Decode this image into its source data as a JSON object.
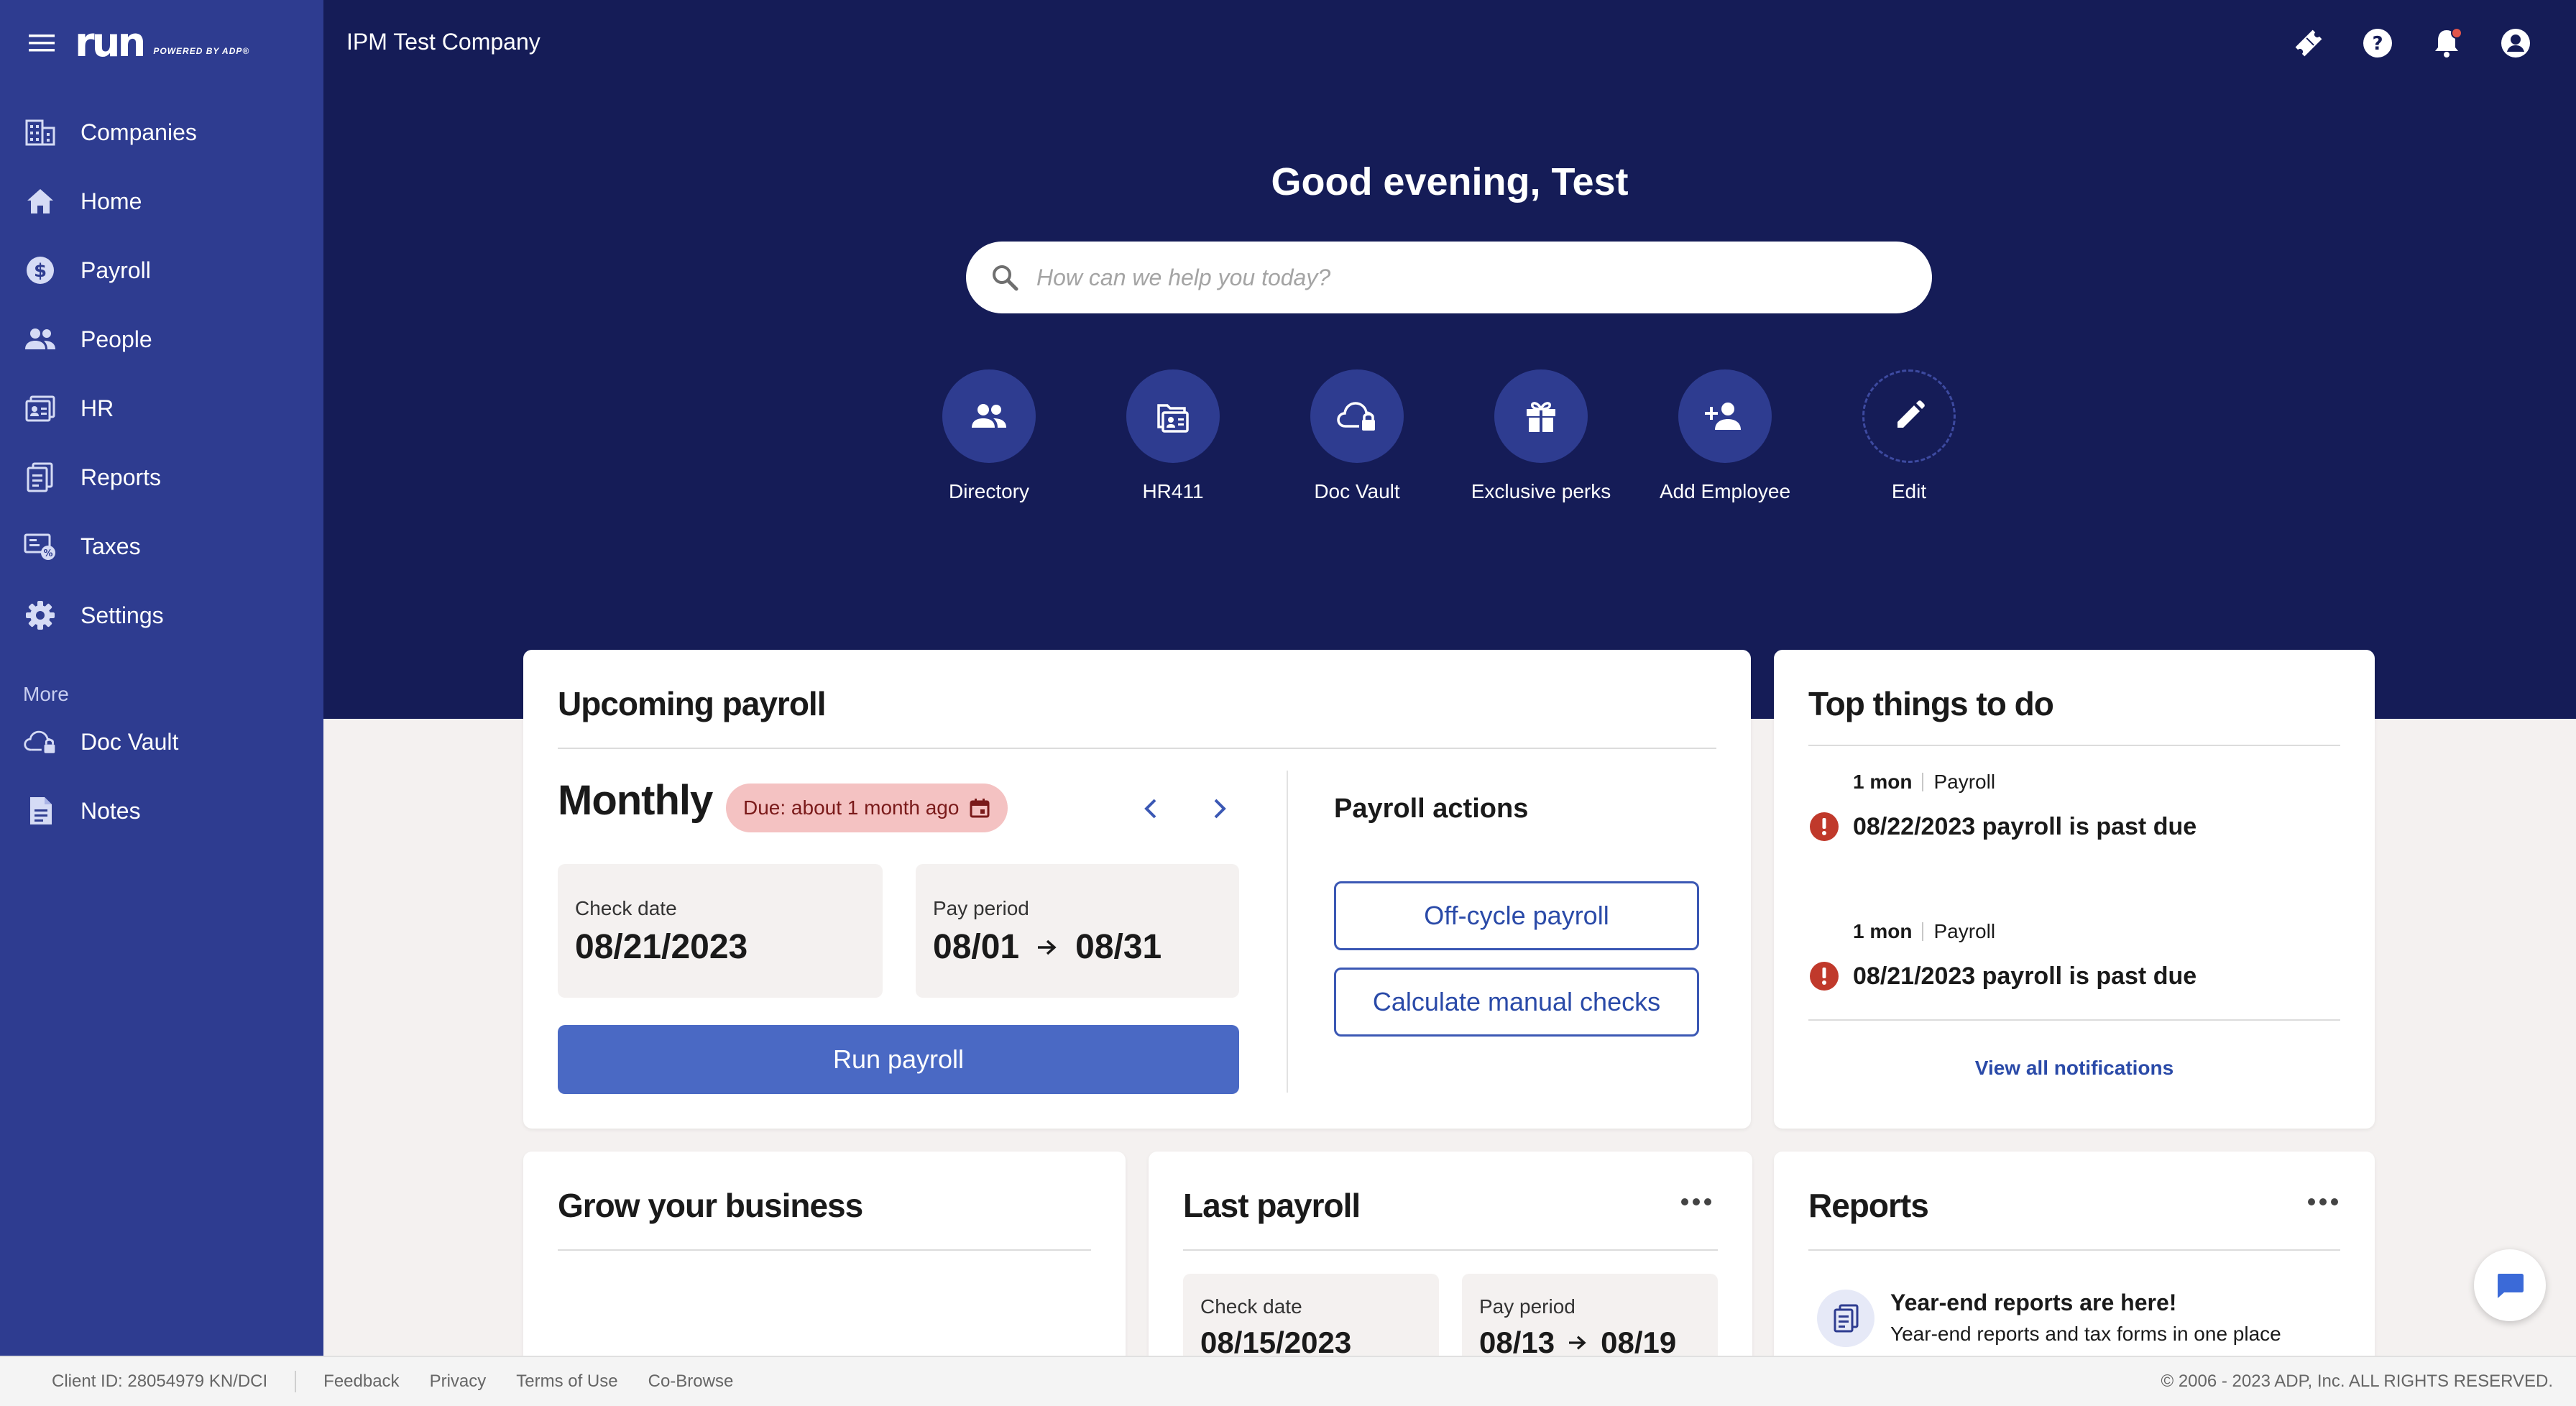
{
  "brand": {
    "logo_text": "run",
    "powered_by": "POWERED BY ADP®"
  },
  "sidebar": {
    "items": [
      {
        "label": "Companies",
        "icon": "building-icon"
      },
      {
        "label": "Home",
        "icon": "home-icon"
      },
      {
        "label": "Payroll",
        "icon": "dollar-icon"
      },
      {
        "label": "People",
        "icon": "people-icon"
      },
      {
        "label": "HR",
        "icon": "hr-folder-icon"
      },
      {
        "label": "Reports",
        "icon": "report-icon"
      },
      {
        "label": "Taxes",
        "icon": "tax-icon"
      },
      {
        "label": "Settings",
        "icon": "gear-icon"
      }
    ],
    "more_label": "More",
    "more_items": [
      {
        "label": "Doc Vault",
        "icon": "cloud-lock-icon"
      },
      {
        "label": "Notes",
        "icon": "note-icon"
      }
    ]
  },
  "header": {
    "company_name": "IPM Test Company",
    "icons": [
      "ticket-icon",
      "help-icon",
      "bell-icon",
      "account-icon"
    ]
  },
  "hero": {
    "greeting": "Good evening, Test",
    "search_placeholder": "How can we help you today?",
    "quick_links": [
      {
        "label": "Directory",
        "icon": "directory-icon"
      },
      {
        "label": "HR411",
        "icon": "hr411-icon"
      },
      {
        "label": "Doc Vault",
        "icon": "cloud-lock-icon"
      },
      {
        "label": "Exclusive perks",
        "icon": "gift-icon"
      },
      {
        "label": "Add Employee",
        "icon": "add-person-icon"
      },
      {
        "label": "Edit",
        "icon": "pencil-icon"
      }
    ]
  },
  "upcoming_payroll": {
    "title": "Upcoming payroll",
    "frequency": "Monthly",
    "due_badge": "Due: about 1 month ago",
    "check_date_label": "Check date",
    "check_date": "08/21/2023",
    "pay_period_label": "Pay period",
    "pay_period_start": "08/01",
    "pay_period_end": "08/31",
    "run_button": "Run payroll",
    "actions_title": "Payroll actions",
    "off_cycle_button": "Off-cycle payroll",
    "manual_checks_button": "Calculate manual checks"
  },
  "top_things": {
    "title": "Top things to do",
    "items": [
      {
        "age": "1 mon",
        "category": "Payroll",
        "text": "08/22/2023 payroll is past due"
      },
      {
        "age": "1 mon",
        "category": "Payroll",
        "text": "08/21/2023 payroll is past due"
      }
    ],
    "view_all": "View all notifications"
  },
  "grow": {
    "title": "Grow your business"
  },
  "last_payroll": {
    "title": "Last payroll",
    "check_date_label": "Check date",
    "check_date": "08/15/2023",
    "pay_period_label": "Pay period",
    "pay_period_start": "08/13",
    "pay_period_end": "08/19"
  },
  "reports": {
    "title": "Reports",
    "heading": "Year-end reports are here!",
    "subtext": "Year-end reports and tax forms in one place"
  },
  "footer": {
    "client_id": "Client ID: 28054979 KN/DCI",
    "links": [
      "Feedback",
      "Privacy",
      "Terms of Use",
      "Co-Browse"
    ],
    "copyright": "© 2006 - 2023 ADP, Inc. ALL RIGHTS RESERVED."
  },
  "colors": {
    "sidebar": "#2e3c90",
    "hero": "#151c57",
    "primary_button": "#4a69c4",
    "accent_text": "#2a4aa8",
    "alert": "#c0392b",
    "due_badge": "#f4c2c2"
  }
}
